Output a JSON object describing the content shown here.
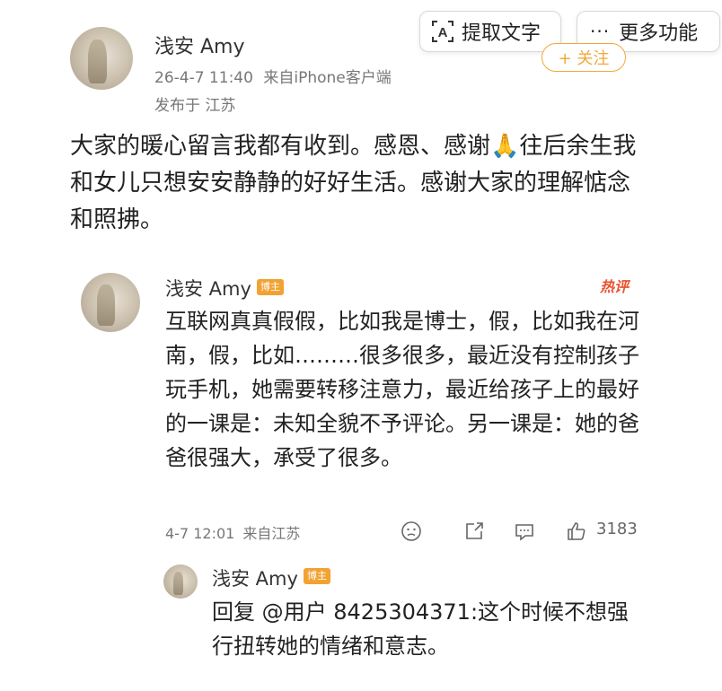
{
  "toolbar": {
    "extract_text_label": "提取文字",
    "more_label": "更多功能",
    "more_dots": "···"
  },
  "post": {
    "author": "浅安 Amy",
    "timestamp": "26-4-7 11:40",
    "source": "来自iPhone客户端",
    "location": "发布于 江苏",
    "follow_label": "+ 关注",
    "text_before_emoji": "大家的暖心留言我都有收到。感恩、感谢",
    "emoji": "🙏",
    "text_after_emoji": "往后余生我和女儿只想安安静静的好好生活。感谢大家的理解惦念和照拂。"
  },
  "reply": {
    "author": "浅安 Amy",
    "badge": "博主",
    "hot_tag": "热评",
    "text": "互联网真真假假，比如我是博士，假，比如我在河南，假，比如………很多很多，最近没有控制孩子玩手机，她需要转移注意力，最近给孩子上的最好的一课是：未知全貌不予评论。另一课是：她的爸爸很强大，承受了很多。",
    "timestamp": "4-7 12:01",
    "source": "来自江苏",
    "like_count": "3183",
    "icons": [
      "dislike-face-icon",
      "share-icon",
      "comment-icon",
      "like-thumb-icon"
    ]
  },
  "sub_reply": {
    "author": "浅安 Amy",
    "badge": "博主",
    "text": "回复 @用户 8425304371:这个时候不想强行扭转她的情绪和意志。"
  },
  "colors": {
    "badge": "#f2a233",
    "follow": "#f0a93a",
    "hot_tag": "#e8532f",
    "meta_gray": "#777777"
  }
}
